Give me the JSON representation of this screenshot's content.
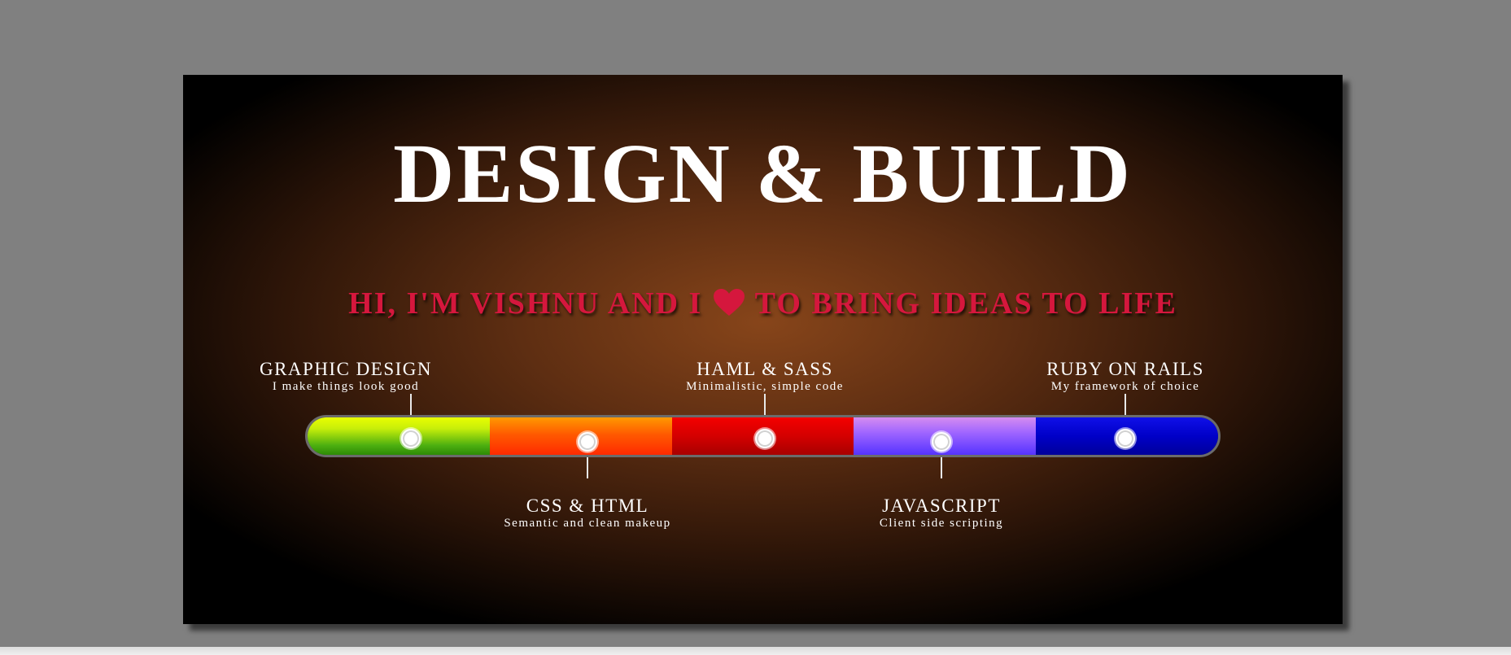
{
  "page": {
    "title": "DESIGN & BUILD",
    "tagline_before": "HI, I'M VISHNU AND I",
    "tagline_after": "TO BRING IDEAS TO LIFE",
    "heart_icon": "heart-icon"
  },
  "colors": {
    "tagline": "#d5173d",
    "page_background": "#808080",
    "banner_center": "#87451a",
    "banner_edge": "#000000"
  },
  "skills": [
    {
      "name": "GRAPHIC DESIGN",
      "desc": "I make things look good",
      "color": "#7ccf0a"
    },
    {
      "name": "CSS & HTML",
      "desc": "Semantic and clean makeup",
      "color": "#ff5a00"
    },
    {
      "name": "HAML & SASS",
      "desc": "Minimalistic, simple code",
      "color": "#d40000"
    },
    {
      "name": "JAVASCRIPT",
      "desc": "Client side scripting",
      "color": "#a066ff"
    },
    {
      "name": "RUBY ON RAILS",
      "desc": "My framework of choice",
      "color": "#0000c8"
    }
  ]
}
